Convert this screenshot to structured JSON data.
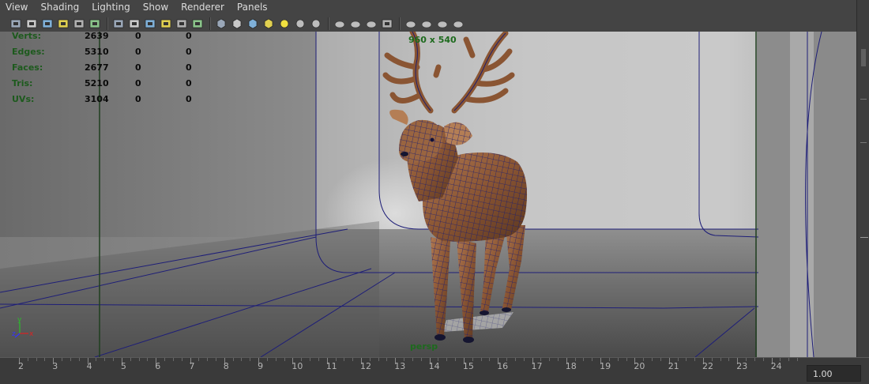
{
  "menu": [
    "View",
    "Shading",
    "Lighting",
    "Show",
    "Renderer",
    "Panels"
  ],
  "toolbar_icons": [
    "camera-select-icon",
    "camera-attributes-icon",
    "bookmark-icon",
    "image-plane-icon",
    "grease-pencil-icon",
    "film-gate-icon",
    "|",
    "grid-icon",
    "resolution-gate-icon",
    "gate-mask-icon",
    "safe-action-icon",
    "field-chart-icon",
    "safe-title-icon",
    "|",
    "wireframe-icon",
    "smooth-shade-icon",
    "wireframe-on-shaded-icon",
    "textured-icon",
    "use-lights-icon",
    "shadows-icon",
    "screen-space-ao-icon",
    "|",
    "motion-blur-icon",
    "anti-aliasing-icon",
    "depth-of-field-icon",
    "isolate-select-icon",
    "|",
    "xray-icon",
    "xray-active-icon",
    "xray-joints-icon",
    "xray-graph-icon"
  ],
  "hud": {
    "rows": [
      {
        "label": "Verts:",
        "v1": "2639",
        "v2": "0",
        "v3": "0"
      },
      {
        "label": "Edges:",
        "v1": "5310",
        "v2": "0",
        "v3": "0"
      },
      {
        "label": "Faces:",
        "v1": "2677",
        "v2": "0",
        "v3": "0"
      },
      {
        "label": "Tris:",
        "v1": "5210",
        "v2": "0",
        "v3": "0"
      },
      {
        "label": "UVs:",
        "v1": "3104",
        "v2": "0",
        "v3": "0"
      }
    ],
    "resolution": "960 x 540",
    "camera": "persp",
    "axis": {
      "y": "y",
      "z": "z",
      "x": "x"
    }
  },
  "timeline": {
    "ticks": [
      "2",
      "3",
      "4",
      "5",
      "6",
      "7",
      "8",
      "9",
      "10",
      "11",
      "12",
      "13",
      "14",
      "15",
      "16",
      "17",
      "18",
      "19",
      "20",
      "21",
      "22",
      "23",
      "24"
    ],
    "current_time": "1.00"
  },
  "colors": {
    "ui_bg": "#444444",
    "hud_label": "#1d5a1d",
    "safe_frame": "#1f3f1f",
    "curve": "#1e1e78",
    "deer_fill": "#8a5a38",
    "deer_wire": "#20207a"
  }
}
